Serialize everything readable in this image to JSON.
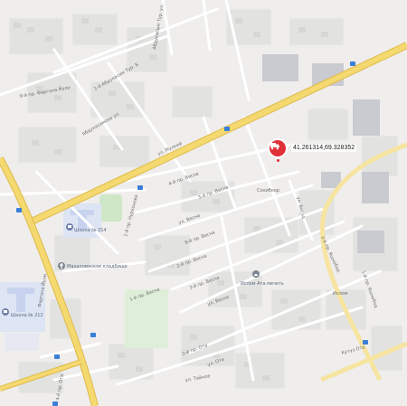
{
  "map": {
    "pin_coordinates": "41.261314,69.328352",
    "colors": {
      "background": "#efeeec",
      "block": "#e2e2e0",
      "building": "#d7d7d5",
      "industrial": "#c9cbd0",
      "major_road": "#f4d970",
      "major_road_edge": "#e0b94a",
      "minor_road": "#ffffff",
      "park": "#cfe6c7",
      "school": "#c7d3ee",
      "marker": "#e03038"
    },
    "icons": [
      "school-icon",
      "cemetery-icon",
      "mosque-icon",
      "transit-stop-icon",
      "location-pin-icon"
    ],
    "streets": {
      "top_left": "9-й пр. Фаргона Йули",
      "abulkasym_1": "1-й Абдукасим Тур. Б",
      "abulkasym_2": "Абдукасым Тур. ул.",
      "abulkasym_3": "Абдукасимова ул.",
      "mulkiy": "ул. Мулкий",
      "vesna_4": "4-й пр. Весна",
      "vesna_5": "5-й пр. Весна",
      "vesna": "ул. Весна",
      "vesna_right": "ул. Весна",
      "vesna_8": "8-й пр. Весна",
      "vesna_1": "1-й пр. Весна",
      "vesna_2": "2-й пр. Весна",
      "vesna_3": "3-й пр. Весна",
      "vesna_main": "ул. Весна",
      "nurkhonov": "1-й пр. Нурхонова",
      "ota_2": "2-й пр. Ота",
      "ota_ul": "ул. Ота",
      "tajnoe": "ул. Тайное",
      "farg_yuli": "Фаргона Йули",
      "yashnobod_2": "2-й пр. Яшнобод",
      "yashnobod_1": "1-й пр. Яшнобод",
      "bottom_left": "4-й пр. Ота",
      "near_pin": "Сохибкор",
      "right_block": "Ислом",
      "bottom_right": "Кутуз Ота"
    },
    "pois": {
      "school_1": "Школа № 214",
      "school_2": "Школа № 212",
      "cemetery": "Махаллинское кладбище",
      "mosque": "Ислом Ата мечеть"
    }
  }
}
